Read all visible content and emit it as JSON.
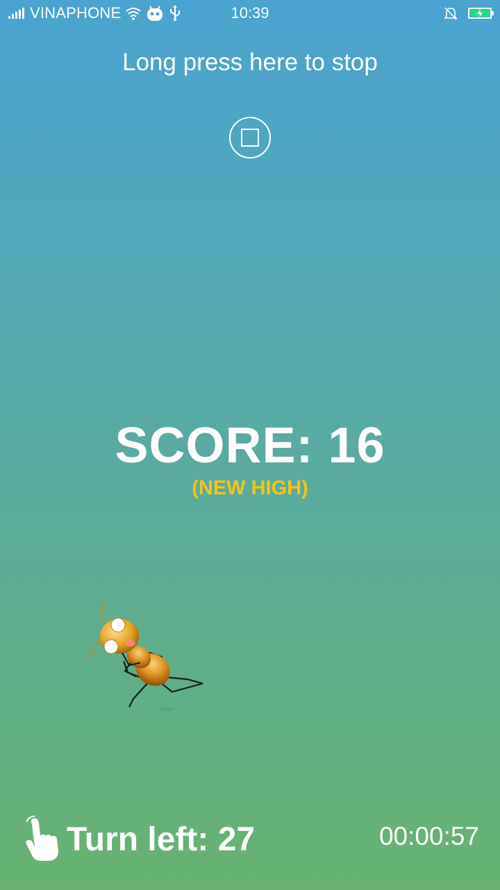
{
  "status_bar": {
    "carrier": "VINAPHONE",
    "time": "10:39",
    "icons": [
      "signal-icon",
      "wifi-icon",
      "android-icon",
      "usb-icon",
      "mute-bell-icon",
      "battery-charging-icon"
    ],
    "battery_color": "#25d98a"
  },
  "stop": {
    "hint": "Long press here to stop",
    "icon": "stop-icon"
  },
  "score": {
    "text": "SCORE: 16",
    "badge": "(NEW HIGH)",
    "badge_color": "#f5c518"
  },
  "bottom": {
    "turn_left": "Turn left: 27",
    "timer": "00:00:57",
    "hand_icon": "tap-hand-icon"
  },
  "colors": {
    "gradient_top": "#4aa3d0",
    "gradient_bottom": "#67b36f",
    "text": "#ffffff"
  }
}
